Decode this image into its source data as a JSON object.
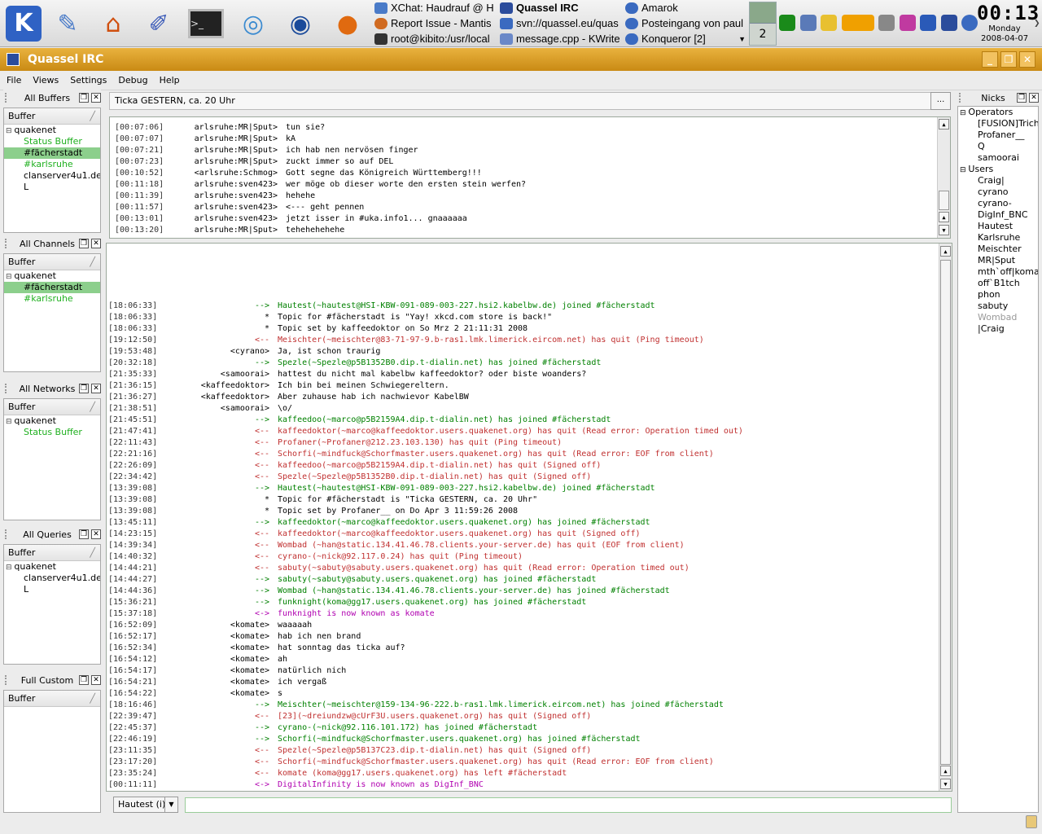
{
  "taskbar": {
    "tasks": [
      {
        "label": "XChat: Haudrauf @ H",
        "color": "#4a7bc8"
      },
      {
        "label": "Quassel IRC",
        "color": "#2b4c9c",
        "bold": true
      },
      {
        "label": "Amarok",
        "color": "#3a6ac0"
      },
      {
        "label": "Report Issue - Mantis",
        "color": "#d06a20"
      },
      {
        "label": "svn://quassel.eu/quas",
        "color": "#3a6ac0"
      },
      {
        "label": "Posteingang von paul",
        "color": "#3a6ac0"
      },
      {
        "label": "root@kibito:/usr/local",
        "color": "#333333"
      },
      {
        "label": "message.cpp - KWrite",
        "color": "#6a88c8"
      },
      {
        "label": "Konqueror [2]",
        "color": "#3a6ac0"
      }
    ],
    "pager_active": "",
    "pager_number": "2",
    "clock_time": "00:13",
    "clock_day": "Monday",
    "clock_date": "2008-04-07"
  },
  "window": {
    "title": "Quassel IRC"
  },
  "menu": [
    "File",
    "Views",
    "Settings",
    "Debug",
    "Help"
  ],
  "docks": {
    "all_buffers": {
      "title": "All Buffers",
      "header": "Buffer",
      "rows": [
        {
          "text": "quakenet",
          "kind": "root"
        },
        {
          "text": "Status Buffer",
          "kind": "child",
          "cls": "c-green"
        },
        {
          "text": "#fächerstadt",
          "kind": "child",
          "cls": "sel"
        },
        {
          "text": "#karlsruhe",
          "kind": "child",
          "cls": "c-green"
        },
        {
          "text": "clanserver4u1.de...",
          "kind": "child"
        },
        {
          "text": "L",
          "kind": "child"
        }
      ]
    },
    "all_channels": {
      "title": "All Channels",
      "header": "Buffer",
      "rows": [
        {
          "text": "quakenet",
          "kind": "root"
        },
        {
          "text": "#fächerstadt",
          "kind": "child",
          "cls": "sel"
        },
        {
          "text": "#karlsruhe",
          "kind": "child",
          "cls": "c-green"
        }
      ]
    },
    "all_networks": {
      "title": "All Networks",
      "header": "Buffer",
      "rows": [
        {
          "text": "quakenet",
          "kind": "root"
        },
        {
          "text": "Status Buffer",
          "kind": "child",
          "cls": "c-green"
        }
      ]
    },
    "all_queries": {
      "title": "All Queries",
      "header": "Buffer",
      "rows": [
        {
          "text": "quakenet",
          "kind": "root"
        },
        {
          "text": "clanserver4u1.de...",
          "kind": "child"
        },
        {
          "text": "L",
          "kind": "child"
        }
      ]
    },
    "full_custom": {
      "title": "Full Custom",
      "header": "Buffer",
      "rows": []
    }
  },
  "topic": {
    "text": "Ticka GESTERN, ca. 20 Uhr",
    "button": "..."
  },
  "upper_chat": [
    {
      "ts": "[00:07:06]",
      "snd": "arlsruhe:MR|Sput>",
      "msg": "tun sie?"
    },
    {
      "ts": "[00:07:07]",
      "snd": "arlsruhe:MR|Sput>",
      "msg": "kA"
    },
    {
      "ts": "[00:07:21]",
      "snd": "arlsruhe:MR|Sput>",
      "msg": "ich hab nen nervösen finger"
    },
    {
      "ts": "[00:07:23]",
      "snd": "arlsruhe:MR|Sput>",
      "msg": "zuckt immer so auf DEL"
    },
    {
      "ts": "[00:10:52]",
      "snd": "<arlsruhe:Schmog>",
      "msg": "Gott segne das Königreich Württemberg!!!"
    },
    {
      "ts": "[00:11:18]",
      "snd": "arlsruhe:sven423>",
      "msg": "wer möge ob dieser worte den ersten stein werfen?"
    },
    {
      "ts": "[00:11:39]",
      "snd": "arlsruhe:sven423>",
      "msg": "hehehe"
    },
    {
      "ts": "[00:11:57]",
      "snd": "arlsruhe:sven423>",
      "msg": "<--- geht pennen"
    },
    {
      "ts": "[00:13:01]",
      "snd": "arlsruhe:sven423>",
      "msg": "jetzt isser in #uka.info1... gnaaaaaa"
    },
    {
      "ts": "[00:13:20]",
      "snd": "arlsruhe:MR|Sput>",
      "msg": "tehehehehehe"
    }
  ],
  "lower_chat": [
    {
      "ts": "[18:06:33]",
      "snd": "-->",
      "k": "join",
      "msg": "Hautest(~hautest@HSI-KBW-091-089-003-227.hsi2.kabelbw.de) joined #fächerstadt"
    },
    {
      "ts": "[18:06:33]",
      "snd": "*",
      "k": "topic",
      "msg": "Topic for #fächerstadt is \"Yay! xkcd.com store is back!\""
    },
    {
      "ts": "[18:06:33]",
      "snd": "*",
      "k": "topic",
      "msg": "Topic set by kaffeedoktor on So Mrz 2 21:11:31 2008"
    },
    {
      "ts": "[19:12:50]",
      "snd": "<--",
      "k": "part",
      "msg": "Meischter(~meischter@83-71-97-9.b-ras1.lmk.limerick.eircom.net) has quit (Ping timeout)"
    },
    {
      "ts": "[19:53:48]",
      "snd": "<cyrano>",
      "k": "say",
      "msg": "Ja, ist schon traurig"
    },
    {
      "ts": "[20:32:18]",
      "snd": "-->",
      "k": "join",
      "msg": "Spezle(~Spezle@p5B1352B0.dip.t-dialin.net) has joined #fächerstadt"
    },
    {
      "ts": "[21:35:33]",
      "snd": "<samoorai>",
      "k": "say",
      "msg": "hattest du nicht mal kabelbw kaffeedoktor? oder biste woanders?"
    },
    {
      "ts": "[21:36:15]",
      "snd": "<kaffeedoktor>",
      "k": "say",
      "msg": "Ich bin bei meinen Schwiegereltern."
    },
    {
      "ts": "[21:36:27]",
      "snd": "<kaffeedoktor>",
      "k": "say",
      "msg": "Aber zuhause hab ich nachwievor KabelBW"
    },
    {
      "ts": "[21:38:51]",
      "snd": "<samoorai>",
      "k": "say",
      "msg": "\\o/"
    },
    {
      "ts": "[21:45:51]",
      "snd": "-->",
      "k": "join",
      "msg": "kaffeedoo(~marco@p5B2159A4.dip.t-dialin.net) has joined #fächerstadt"
    },
    {
      "ts": "[21:47:41]",
      "snd": "<--",
      "k": "part",
      "msg": "kaffeedoktor(~marco@kaffeedoktor.users.quakenet.org) has quit (Read error: Operation timed out)"
    },
    {
      "ts": "[22:11:43]",
      "snd": "<--",
      "k": "part",
      "msg": "Profaner(~Profaner@212.23.103.130) has quit (Ping timeout)"
    },
    {
      "ts": "[22:21:16]",
      "snd": "<--",
      "k": "part",
      "msg": "Schorfi(~mindfuck@Schorfmaster.users.quakenet.org) has quit (Read error: EOF from client)"
    },
    {
      "ts": "[22:26:09]",
      "snd": "<--",
      "k": "part",
      "msg": "kaffeedoo(~marco@p5B2159A4.dip.t-dialin.net) has quit (Signed off)"
    },
    {
      "ts": "[22:34:42]",
      "snd": "<--",
      "k": "part",
      "msg": "Spezle(~Spezle@p5B1352B0.dip.t-dialin.net) has quit (Signed off)"
    },
    {
      "ts": "[13:39:08]",
      "snd": "-->",
      "k": "join",
      "msg": "Hautest(~hautest@HSI-KBW-091-089-003-227.hsi2.kabelbw.de) joined #fächerstadt"
    },
    {
      "ts": "[13:39:08]",
      "snd": "*",
      "k": "topic",
      "msg": "Topic for #fächerstadt is \"Ticka GESTERN, ca. 20 Uhr\""
    },
    {
      "ts": "[13:39:08]",
      "snd": "*",
      "k": "topic",
      "msg": "Topic set by Profaner__ on Do Apr 3 11:59:26 2008"
    },
    {
      "ts": "[13:45:11]",
      "snd": "-->",
      "k": "join",
      "msg": "kaffeedoktor(~marco@kaffeedoktor.users.quakenet.org) has joined #fächerstadt"
    },
    {
      "ts": "[14:23:15]",
      "snd": "<--",
      "k": "part",
      "msg": "kaffeedoktor(~marco@kaffeedoktor.users.quakenet.org) has quit (Signed off)"
    },
    {
      "ts": "[14:39:34]",
      "snd": "<--",
      "k": "part",
      "msg": "Wombad (~han@static.134.41.46.78.clients.your-server.de) has quit (EOF from client)"
    },
    {
      "ts": "[14:40:32]",
      "snd": "<--",
      "k": "part",
      "msg": "cyrano-(~nick@92.117.0.24) has quit (Ping timeout)"
    },
    {
      "ts": "[14:44:21]",
      "snd": "<--",
      "k": "part",
      "msg": "sabuty(~sabuty@sabuty.users.quakenet.org) has quit (Read error: Operation timed out)"
    },
    {
      "ts": "[14:44:27]",
      "snd": "-->",
      "k": "join",
      "msg": "sabuty(~sabuty@sabuty.users.quakenet.org) has joined #fächerstadt"
    },
    {
      "ts": "[14:44:36]",
      "snd": "-->",
      "k": "join",
      "msg": "Wombad (~han@static.134.41.46.78.clients.your-server.de) has joined #fächerstadt"
    },
    {
      "ts": "[15:36:21]",
      "snd": "-->",
      "k": "join",
      "msg": "funknight(koma@gg17.users.quakenet.org) has joined #fächerstadt"
    },
    {
      "ts": "[15:37:18]",
      "snd": "<->",
      "k": "nick",
      "msg": "funknight is now known as komate"
    },
    {
      "ts": "[16:52:09]",
      "snd": "<komate>",
      "k": "say",
      "msg": "waaaaah"
    },
    {
      "ts": "[16:52:17]",
      "snd": "<komate>",
      "k": "say",
      "msg": "hab ich nen brand"
    },
    {
      "ts": "[16:52:34]",
      "snd": "<komate>",
      "k": "say",
      "msg": "hat sonntag das ticka auf?"
    },
    {
      "ts": "[16:54:12]",
      "snd": "<komate>",
      "k": "say",
      "msg": "ah"
    },
    {
      "ts": "[16:54:17]",
      "snd": "<komate>",
      "k": "say",
      "msg": "natürlich nich"
    },
    {
      "ts": "[16:54:21]",
      "snd": "<komate>",
      "k": "say",
      "msg": "ich vergaß"
    },
    {
      "ts": "[16:54:22]",
      "snd": "<komate>",
      "k": "say",
      "msg": "s"
    },
    {
      "ts": "[18:16:46]",
      "snd": "-->",
      "k": "join",
      "msg": "Meischter(~meischter@159-134-96-222.b-ras1.lmk.limerick.eircom.net) has joined #fächerstadt"
    },
    {
      "ts": "[22:39:47]",
      "snd": "<--",
      "k": "part",
      "msg": "[23](~dreiundzw@cUrF3U.users.quakenet.org) has quit (Signed off)"
    },
    {
      "ts": "[22:45:37]",
      "snd": "-->",
      "k": "join",
      "msg": "cyrano-(~nick@92.116.101.172) has joined #fächerstadt"
    },
    {
      "ts": "[22:46:19]",
      "snd": "-->",
      "k": "join",
      "msg": "Schorfi(~mindfuck@Schorfmaster.users.quakenet.org) has joined #fächerstadt"
    },
    {
      "ts": "[23:11:35]",
      "snd": "<--",
      "k": "part",
      "msg": "Spezle(~Spezle@p5B137C23.dip.t-dialin.net) has quit (Signed off)"
    },
    {
      "ts": "[23:17:20]",
      "snd": "<--",
      "k": "part",
      "msg": "Schorfi(~mindfuck@Schorfmaster.users.quakenet.org) has quit (Read error: EOF from client)"
    },
    {
      "ts": "[23:35:24]",
      "snd": "<--",
      "k": "part",
      "msg": "komate (koma@gg17.users.quakenet.org) has left #fächerstadt"
    },
    {
      "ts": "[00:11:11]",
      "snd": "<->",
      "k": "nick",
      "msg": "DigitalInfinity is now known as DigInf_BNC"
    }
  ],
  "input": {
    "nick": "Hautest (i)",
    "value": ""
  },
  "nicks": {
    "title": "Nicks",
    "groups": [
      {
        "name": "Operators",
        "items": [
          "[FUSION]Trich",
          "Profaner__",
          "Q",
          "samoorai"
        ]
      },
      {
        "name": "Users",
        "items": [
          "Craig|",
          "cyrano",
          "cyrano-",
          "DigInf_BNC",
          "Hautest",
          "Karlsruhe",
          "Meischter",
          "MR|Sput",
          "mth`off|koma",
          "off`B1tch",
          "phon",
          "sabuty",
          "Wombad",
          "|Craig"
        ],
        "grey": [
          "Wombad"
        ]
      }
    ]
  }
}
